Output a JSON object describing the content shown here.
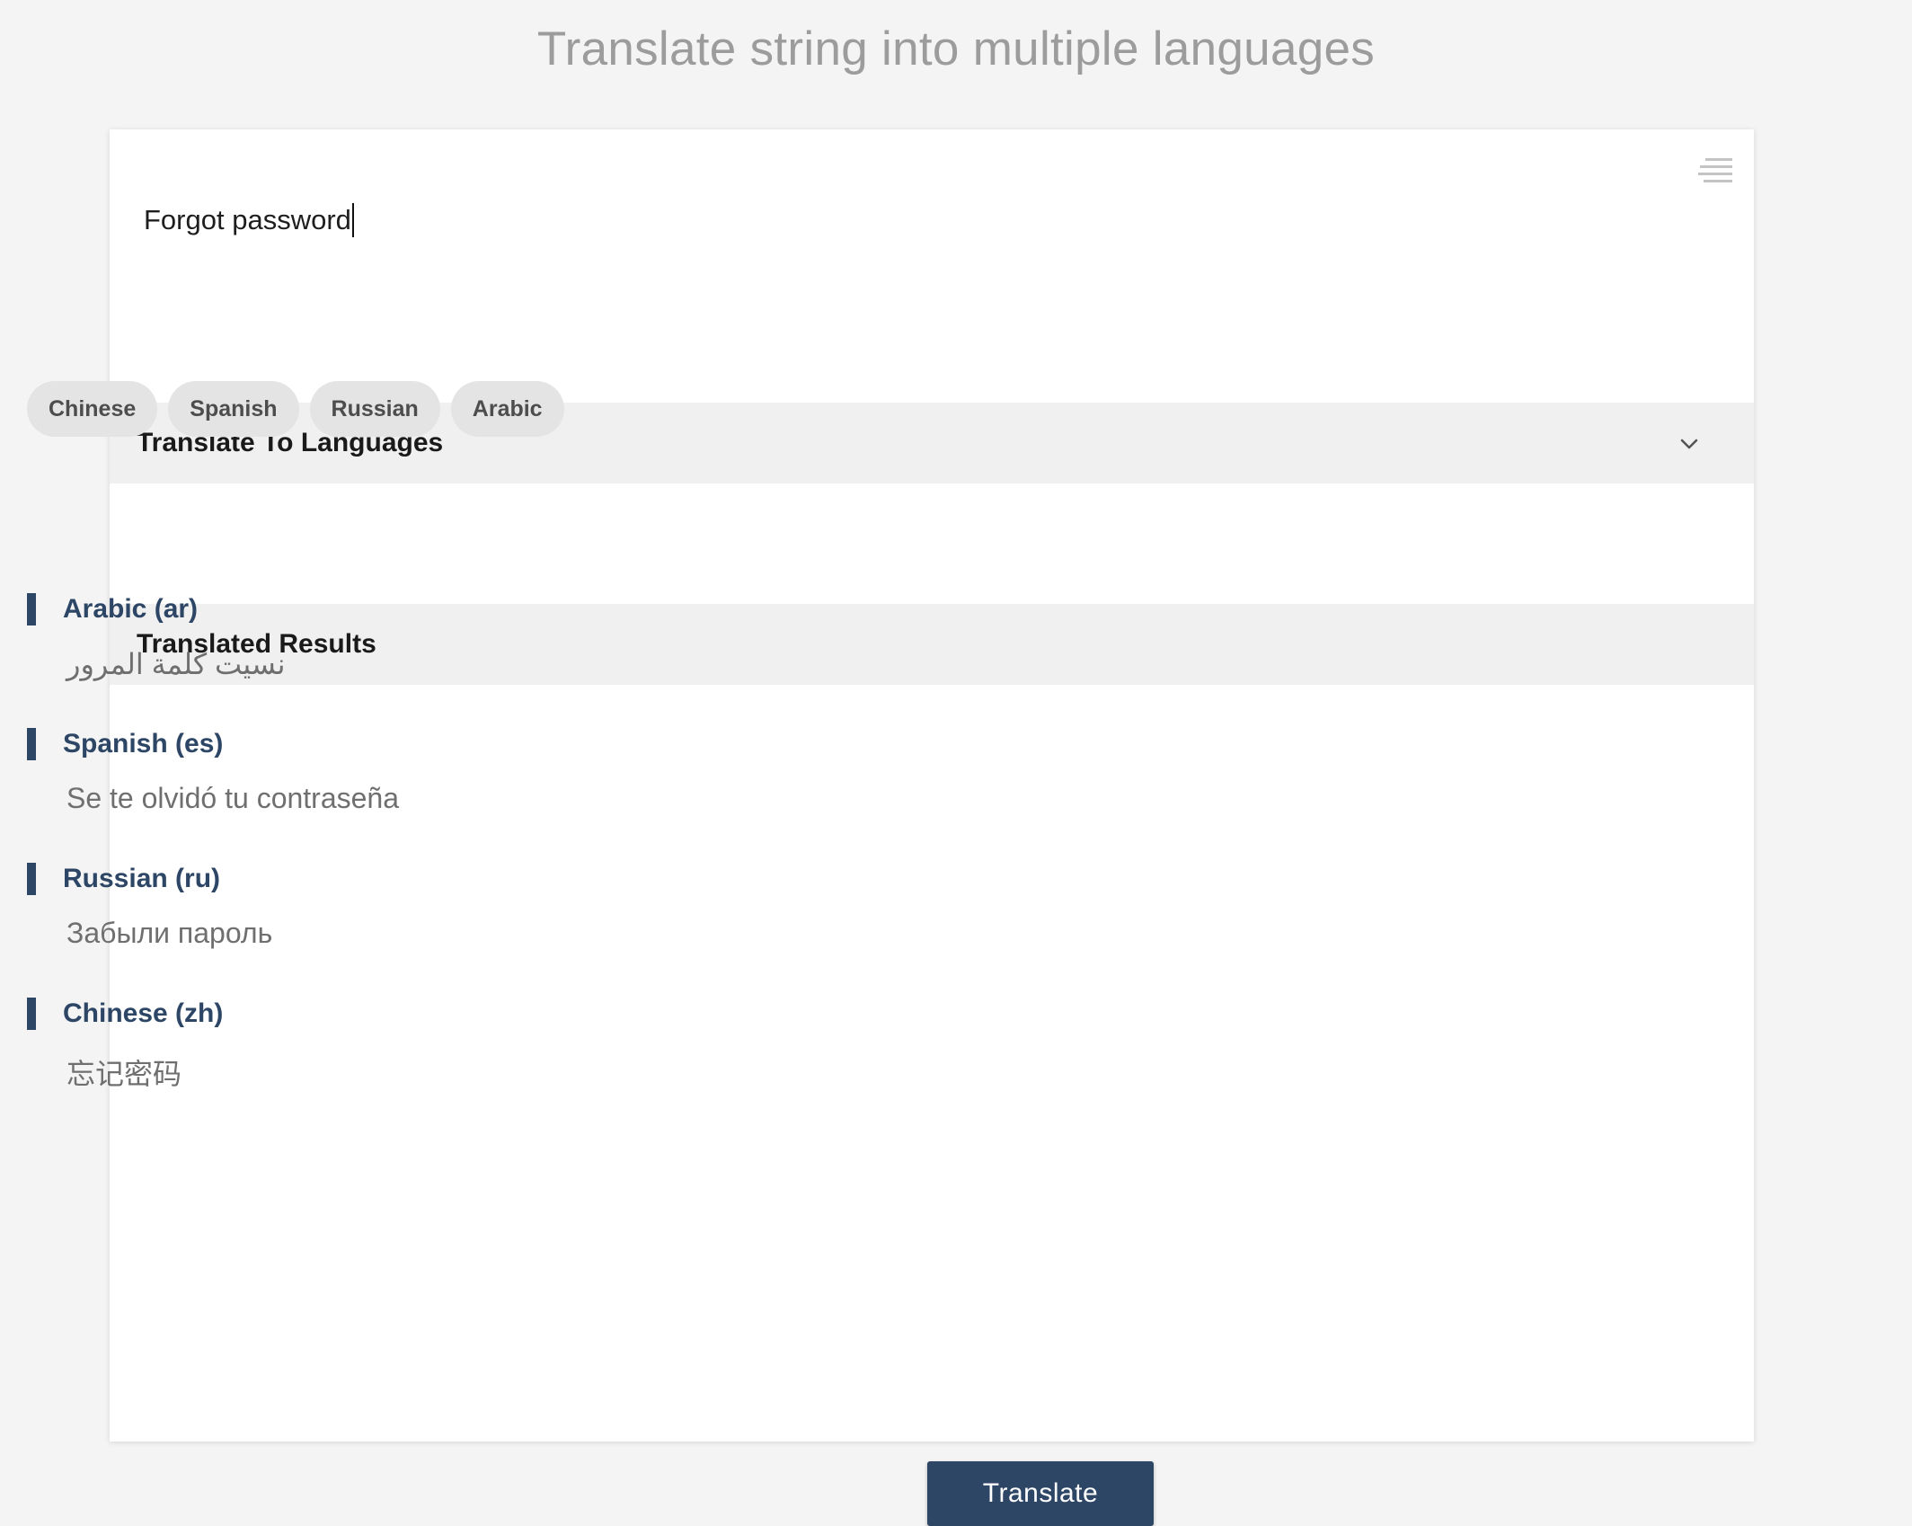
{
  "page": {
    "title": "Translate string into multiple languages"
  },
  "source": {
    "value": "Forgot password"
  },
  "icons": {
    "menu": "lines-icon",
    "chevron": "chevron-down-icon"
  },
  "languages_section": {
    "label": "Translate To Languages",
    "chips": [
      "Chinese",
      "Spanish",
      "Russian",
      "Arabic"
    ]
  },
  "results_section": {
    "label": "Translated Results",
    "items": [
      {
        "language": "Arabic (ar)",
        "text": "نسيت كلمة المرور"
      },
      {
        "language": "Spanish (es)",
        "text": "Se te olvidó tu contraseña"
      },
      {
        "language": "Russian (ru)",
        "text": "Забыли пароль"
      },
      {
        "language": "Chinese (zh)",
        "text": "忘记密码"
      }
    ]
  },
  "actions": {
    "translate_label": "Translate"
  },
  "colors": {
    "accent": "#2d4666",
    "background": "#f4f4f4",
    "section_bar": "#f0f0f0",
    "chip": "#e4e4e4"
  }
}
